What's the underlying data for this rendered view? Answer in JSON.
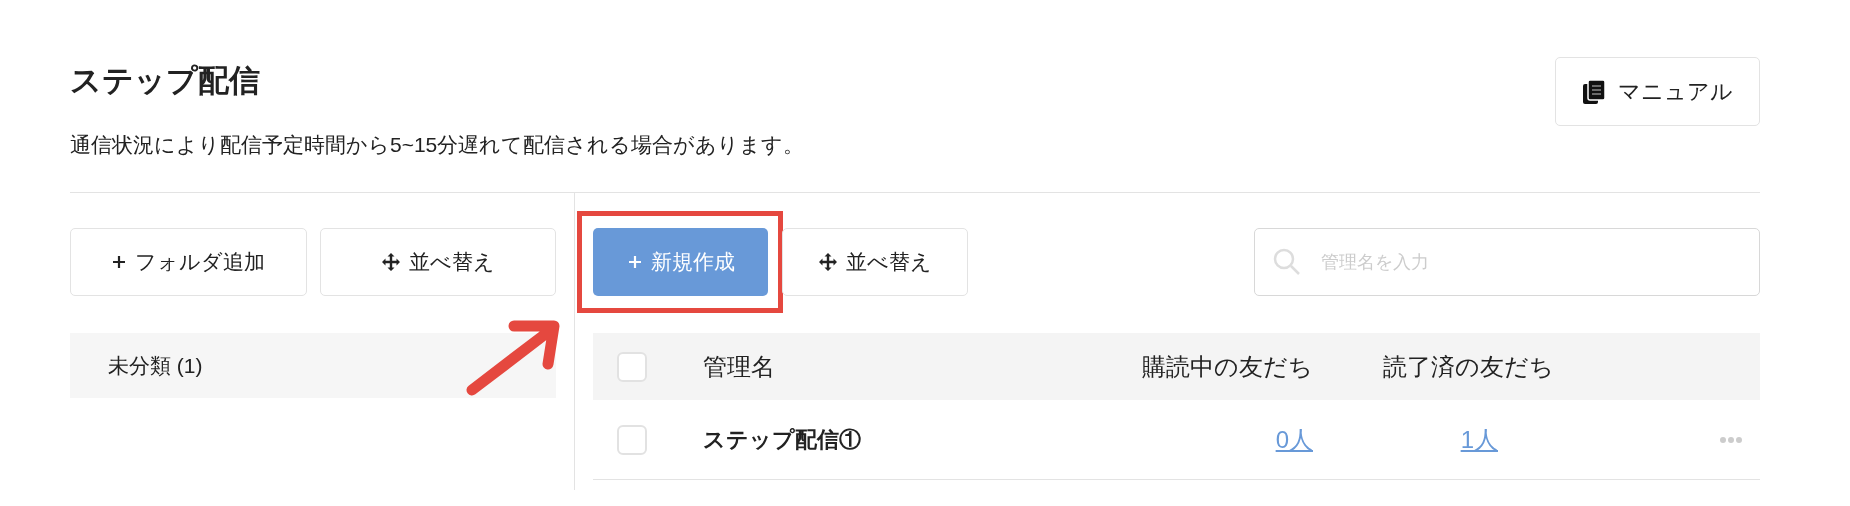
{
  "header": {
    "title": "ステップ配信",
    "notice": "通信状況により配信予定時間から5~15分遅れて配信される場合があります。",
    "manual_button": "マニュアル"
  },
  "sidebar": {
    "buttons": [
      {
        "label": "フォルダ追加",
        "kind": "add"
      },
      {
        "label": "並べ替え",
        "kind": "sort"
      }
    ],
    "folders": [
      {
        "label": "未分類 (1)"
      }
    ]
  },
  "toolbar": {
    "buttons": [
      {
        "label": "新規作成",
        "kind": "primary",
        "highlighted": true
      },
      {
        "label": "並べ替え",
        "kind": "sort",
        "highlighted": false
      }
    ],
    "search": {
      "placeholder": "管理名を入力"
    }
  },
  "table": {
    "select_all": {
      "checked": false
    },
    "columns": [
      "管理名",
      "購読中の友だち",
      "読了済の友だち"
    ],
    "rows": [
      {
        "checked": false,
        "name": "ステップ配信①",
        "subscribers": "0人",
        "read": "1人"
      }
    ]
  }
}
